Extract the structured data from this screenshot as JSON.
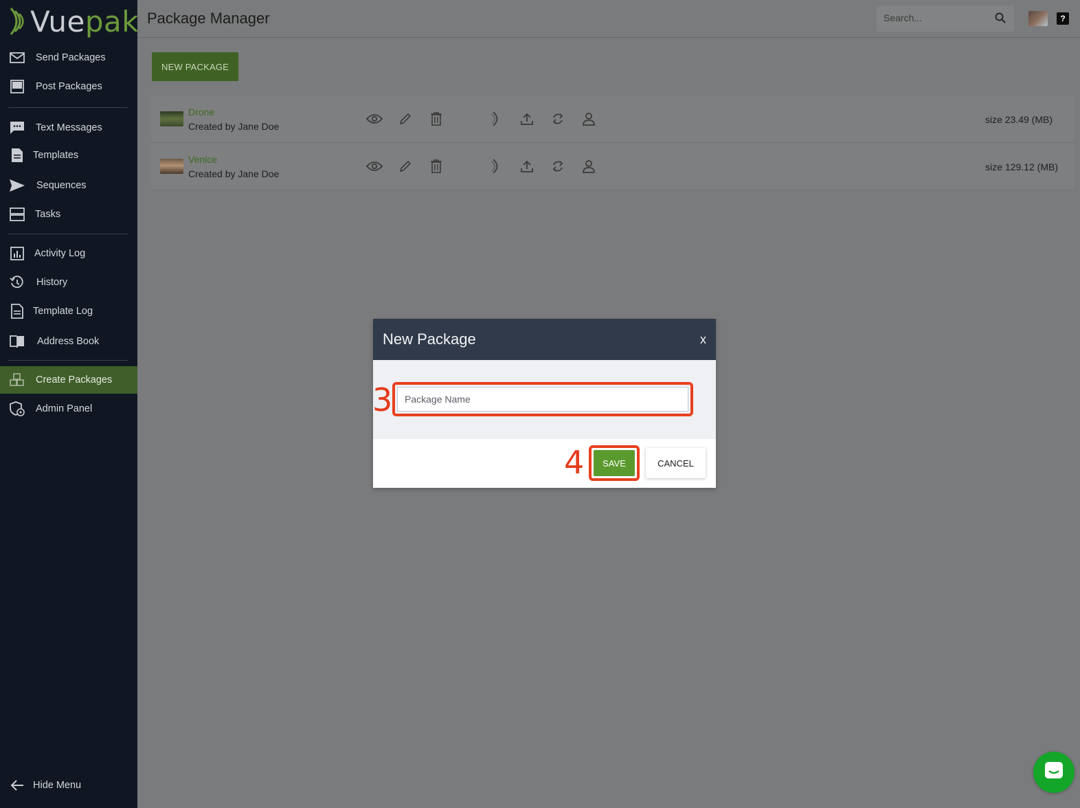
{
  "brand": {
    "name_part1": "Vue",
    "name_part2": "pak"
  },
  "sidebar": {
    "items": [
      {
        "label": "Send Packages",
        "icon": "envelope-icon"
      },
      {
        "label": "Post Packages",
        "icon": "monitor-icon"
      },
      {
        "label": "Text Messages",
        "icon": "chat-icon"
      },
      {
        "label": "Templates",
        "icon": "document-icon"
      },
      {
        "label": "Sequences",
        "icon": "send-icon"
      },
      {
        "label": "Tasks",
        "icon": "tasks-icon"
      },
      {
        "label": "Activity Log",
        "icon": "bar-chart-icon"
      },
      {
        "label": "History",
        "icon": "history-icon"
      },
      {
        "label": "Template Log",
        "icon": "document-icon"
      },
      {
        "label": "Address Book",
        "icon": "book-icon"
      },
      {
        "label": "Create Packages",
        "icon": "boxes-icon",
        "active": true
      },
      {
        "label": "Admin Panel",
        "icon": "admin-shield-icon"
      }
    ],
    "hide_menu_label": "Hide Menu"
  },
  "header": {
    "title": "Package Manager",
    "search_placeholder": "Search...",
    "help_label": "?"
  },
  "main": {
    "new_package_label": "NEW PACKAGE",
    "packages": [
      {
        "name": "Drone",
        "creator": "Created by Jane Doe",
        "size": "size 23.49 (MB)"
      },
      {
        "name": "Venice",
        "creator": "Created by Jane Doe",
        "size": "size 129.12 (MB)"
      }
    ]
  },
  "modal": {
    "title": "New Package",
    "close_label": "x",
    "name_placeholder": "Package Name",
    "name_value": "",
    "save_label": "SAVE",
    "cancel_label": "CANCEL",
    "step_name_field": "3",
    "step_save": "4"
  },
  "colors": {
    "sidebar_bg": "#111722",
    "accent_green": "#5a9a2e",
    "modal_header": "#303a4a",
    "highlight_red": "#e8401f",
    "chat_green": "#14a629"
  }
}
